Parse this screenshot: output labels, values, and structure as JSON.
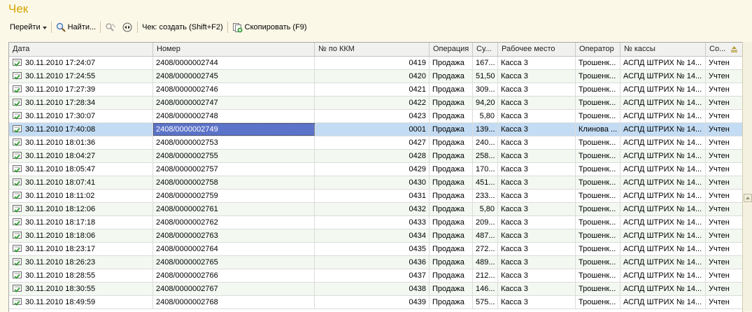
{
  "window": {
    "title": "Чек"
  },
  "toolbar": {
    "goto_label": "Перейти",
    "find_label": "Найти...",
    "create_label": "Чек: создать (Shift+F2)",
    "copy_label": "Скопировать (F9)"
  },
  "table": {
    "columns": [
      "Дата",
      "Номер",
      "№ по ККМ",
      "Операция",
      "Су...",
      "Рабочее место",
      "Оператор",
      "№ кассы",
      "Со..."
    ],
    "selected_index": 5,
    "rows": [
      {
        "date": "30.11.2010 17:24:07",
        "number": "2408/0000002744",
        "kkm": "0419",
        "op": "Продажа",
        "sum": "167...",
        "place": "Касса 3",
        "operator": "Трошенк...",
        "register": "АСПД ШТРИХ № 14...",
        "status": "Учтен"
      },
      {
        "date": "30.11.2010 17:24:55",
        "number": "2408/0000002745",
        "kkm": "0420",
        "op": "Продажа",
        "sum": "51,50",
        "place": "Касса 3",
        "operator": "Трошенк...",
        "register": "АСПД ШТРИХ № 14...",
        "status": "Учтен"
      },
      {
        "date": "30.11.2010 17:27:39",
        "number": "2408/0000002746",
        "kkm": "0421",
        "op": "Продажа",
        "sum": "309...",
        "place": "Касса 3",
        "operator": "Трошенк...",
        "register": "АСПД ШТРИХ № 14...",
        "status": "Учтен"
      },
      {
        "date": "30.11.2010 17:28:34",
        "number": "2408/0000002747",
        "kkm": "0422",
        "op": "Продажа",
        "sum": "94,20",
        "place": "Касса 3",
        "operator": "Трошенк...",
        "register": "АСПД ШТРИХ № 14...",
        "status": "Учтен"
      },
      {
        "date": "30.11.2010 17:30:07",
        "number": "2408/0000002748",
        "kkm": "0423",
        "op": "Продажа",
        "sum": "5,80",
        "place": "Касса 3",
        "operator": "Трошенк...",
        "register": "АСПД ШТРИХ № 14...",
        "status": "Учтен"
      },
      {
        "date": "30.11.2010 17:40:08",
        "number": "2408/0000002749",
        "kkm": "0001",
        "op": "Продажа",
        "sum": "139...",
        "place": "Касса 3",
        "operator": "Клинова ...",
        "register": "АСПД ШТРИХ № 14...",
        "status": "Учтен"
      },
      {
        "date": "30.11.2010 18:01:36",
        "number": "2408/0000002753",
        "kkm": "0427",
        "op": "Продажа",
        "sum": "240...",
        "place": "Касса 3",
        "operator": "Трошенк...",
        "register": "АСПД ШТРИХ № 14...",
        "status": "Учтен"
      },
      {
        "date": "30.11.2010 18:04:27",
        "number": "2408/0000002755",
        "kkm": "0428",
        "op": "Продажа",
        "sum": "258...",
        "place": "Касса 3",
        "operator": "Трошенк...",
        "register": "АСПД ШТРИХ № 14...",
        "status": "Учтен"
      },
      {
        "date": "30.11.2010 18:05:47",
        "number": "2408/0000002757",
        "kkm": "0429",
        "op": "Продажа",
        "sum": "170...",
        "place": "Касса 3",
        "operator": "Трошенк...",
        "register": "АСПД ШТРИХ № 14...",
        "status": "Учтен"
      },
      {
        "date": "30.11.2010 18:07:41",
        "number": "2408/0000002758",
        "kkm": "0430",
        "op": "Продажа",
        "sum": "451...",
        "place": "Касса 3",
        "operator": "Трошенк...",
        "register": "АСПД ШТРИХ № 14...",
        "status": "Учтен"
      },
      {
        "date": "30.11.2010 18:11:02",
        "number": "2408/0000002759",
        "kkm": "0431",
        "op": "Продажа",
        "sum": "233...",
        "place": "Касса 3",
        "operator": "Трошенк...",
        "register": "АСПД ШТРИХ № 14...",
        "status": "Учтен"
      },
      {
        "date": "30.11.2010 18:12:06",
        "number": "2408/0000002761",
        "kkm": "0432",
        "op": "Продажа",
        "sum": "5,80",
        "place": "Касса 3",
        "operator": "Трошенк...",
        "register": "АСПД ШТРИХ № 14...",
        "status": "Учтен"
      },
      {
        "date": "30.11.2010 18:17:18",
        "number": "2408/0000002762",
        "kkm": "0433",
        "op": "Продажа",
        "sum": "209...",
        "place": "Касса 3",
        "operator": "Трошенк...",
        "register": "АСПД ШТРИХ № 14...",
        "status": "Учтен"
      },
      {
        "date": "30.11.2010 18:18:06",
        "number": "2408/0000002763",
        "kkm": "0434",
        "op": "Продажа",
        "sum": "487...",
        "place": "Касса 3",
        "operator": "Трошенк...",
        "register": "АСПД ШТРИХ № 14...",
        "status": "Учтен"
      },
      {
        "date": "30.11.2010 18:23:17",
        "number": "2408/0000002764",
        "kkm": "0435",
        "op": "Продажа",
        "sum": "272...",
        "place": "Касса 3",
        "operator": "Трошенк...",
        "register": "АСПД ШТРИХ № 14...",
        "status": "Учтен"
      },
      {
        "date": "30.11.2010 18:26:23",
        "number": "2408/0000002765",
        "kkm": "0436",
        "op": "Продажа",
        "sum": "489...",
        "place": "Касса 3",
        "operator": "Трошенк...",
        "register": "АСПД ШТРИХ № 14...",
        "status": "Учтен"
      },
      {
        "date": "30.11.2010 18:28:55",
        "number": "2408/0000002766",
        "kkm": "0437",
        "op": "Продажа",
        "sum": "212...",
        "place": "Касса 3",
        "operator": "Трошенк...",
        "register": "АСПД ШТРИХ № 14...",
        "status": "Учтен"
      },
      {
        "date": "30.11.2010 18:30:55",
        "number": "2408/0000002767",
        "kkm": "0438",
        "op": "Продажа",
        "sum": "146...",
        "place": "Касса 3",
        "operator": "Трошенк...",
        "register": "АСПД ШТРИХ № 14...",
        "status": "Учтен"
      },
      {
        "date": "30.11.2010 18:49:59",
        "number": "2408/0000002768",
        "kkm": "0439",
        "op": "Продажа",
        "sum": "575...",
        "place": "Касса 3",
        "operator": "Трошенк...",
        "register": "АСПД ШТРИХ № 14...",
        "status": "Учтен"
      }
    ]
  },
  "colors": {
    "title": "#d8a400",
    "selection": "#c3dcf3",
    "focus_cell": "#5b73c8",
    "alt_row": "#f3f8f1"
  },
  "icons": {
    "row": "document-posted-icon",
    "find": "magnifier-icon",
    "copy": "copy-add-icon"
  }
}
